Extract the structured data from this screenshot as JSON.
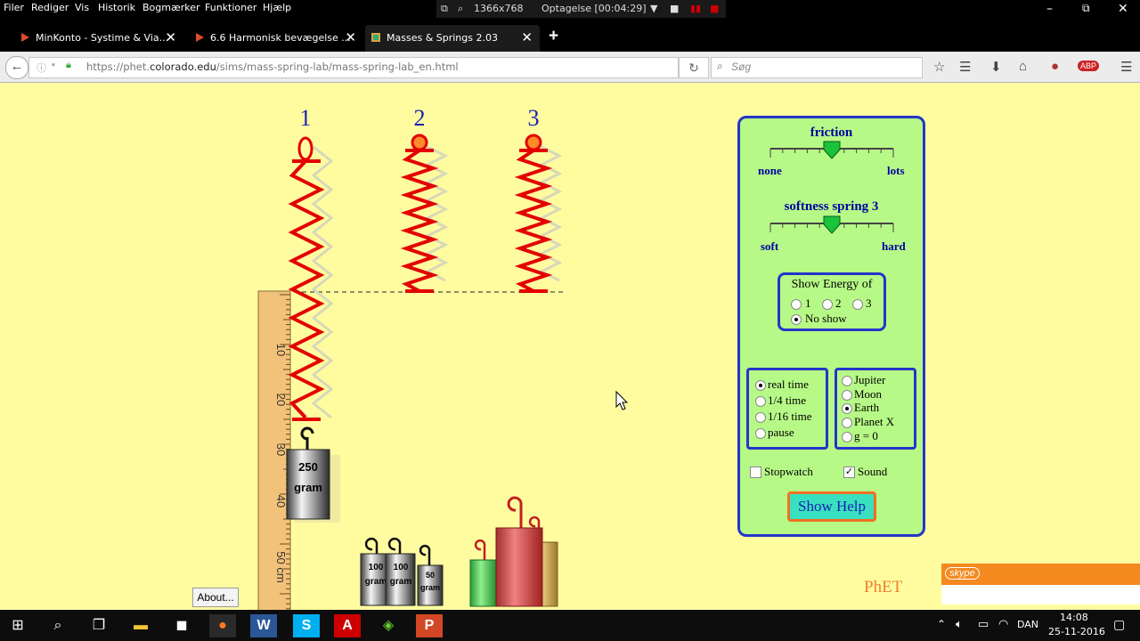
{
  "menubar": {
    "items": [
      "Filer",
      "Rediger",
      "Vis",
      "Historik",
      "Bogmærker",
      "Funktioner",
      "Hjælp"
    ],
    "resolution": "1366x768",
    "recording": "Optagelse [00:04:29]"
  },
  "tabs": [
    {
      "label": "MinKonto - Systime & Via...",
      "active": false
    },
    {
      "label": "6.6 Harmonisk bevægelse ...",
      "active": false
    },
    {
      "label": "Masses & Springs 2.03",
      "active": true
    }
  ],
  "nav": {
    "url_prefix": "https://phet.",
    "url_domain": "colorado.edu",
    "url_path": "/sims/mass-spring-lab/mass-spring-lab_en.html",
    "search_placeholder": "Søg"
  },
  "sim": {
    "spring_labels": [
      "1",
      "2",
      "3"
    ],
    "ruler_labels": [
      "10",
      "20",
      "30",
      "40",
      "50 cm"
    ],
    "hanging_mass": {
      "line1": "250",
      "line2": "gram"
    },
    "small_masses": [
      {
        "line1": "100",
        "line2": "gram"
      },
      {
        "line1": "100",
        "line2": "gram"
      },
      {
        "line1": "50",
        "line2": "gram"
      }
    ],
    "about_button": "About...",
    "logo": "PhET"
  },
  "panel": {
    "friction": {
      "title": "friction",
      "min": "none",
      "max": "lots",
      "level": 0.5
    },
    "softness": {
      "title": "softness spring 3",
      "min": "soft",
      "max": "hard",
      "level": 0.5
    },
    "energy": {
      "title": "Show Energy of",
      "options": [
        "1",
        "2",
        "3"
      ],
      "none_label": "No show",
      "selected": "No show"
    },
    "time": {
      "options": [
        "real time",
        "1/4 time",
        "1/16 time",
        "pause"
      ],
      "selected": "real time"
    },
    "gravity": {
      "options": [
        "Jupiter",
        "Moon",
        "Earth",
        "Planet X",
        "g = 0"
      ],
      "selected": "Earth"
    },
    "stopwatch_label": "Stopwatch",
    "stopwatch_checked": false,
    "sound_label": "Sound",
    "sound_checked": true,
    "help_button": "Show Help"
  },
  "taskbar": {
    "language": "DAN",
    "time": "14:08",
    "date": "25-11-2016"
  },
  "skype": {
    "label": "skype"
  },
  "colors": {
    "background": "#fffca0",
    "panel": "#b7f986",
    "panel_border": "#2535c9",
    "spring": "#e30000"
  }
}
